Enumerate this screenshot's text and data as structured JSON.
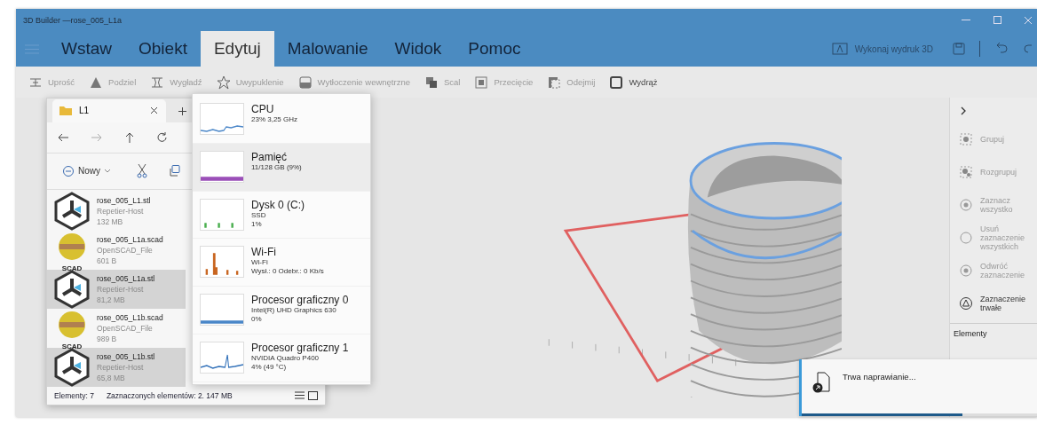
{
  "window": {
    "title": "3D Builder —rose_005_L1a"
  },
  "ribbon_tabs": [
    {
      "label": "Wstaw",
      "selected": false
    },
    {
      "label": "Obiekt",
      "selected": false
    },
    {
      "label": "Edytuj",
      "selected": true
    },
    {
      "label": "Malowanie",
      "selected": false
    },
    {
      "label": "Widok",
      "selected": false
    },
    {
      "label": "Pomoc",
      "selected": false
    }
  ],
  "print_button": {
    "label": "Wykonaj wydruk 3D"
  },
  "toolbar": [
    {
      "label": "Uprość",
      "kind": "simplify",
      "disabled": true
    },
    {
      "label": "Podziel",
      "kind": "split",
      "disabled": true
    },
    {
      "label": "Wygładź",
      "kind": "smooth",
      "disabled": true
    },
    {
      "label": "Uwypuklenie",
      "kind": "star",
      "disabled": true
    },
    {
      "label": "Wytłoczenie wewnętrzne",
      "kind": "emboss",
      "disabled": true
    },
    {
      "label": "Scal",
      "kind": "merge",
      "disabled": true
    },
    {
      "label": "Przecięcie",
      "kind": "intersect",
      "disabled": true
    },
    {
      "label": "Odejmij",
      "kind": "subtract",
      "disabled": true
    },
    {
      "label": "Wydrąż",
      "kind": "hollow",
      "disabled": false
    }
  ],
  "side_panel": {
    "items": [
      {
        "label": "Grupuj",
        "kind": "group",
        "disabled": true
      },
      {
        "label": "Rozgrupuj",
        "kind": "ungroup",
        "disabled": true
      },
      {
        "label": "Zaznacz wszystko",
        "kind": "select",
        "disabled": true
      },
      {
        "label": "Usuń zaznaczenie wszystkich",
        "kind": "circle",
        "disabled": true
      },
      {
        "label": "Odwróć zaznaczenie",
        "kind": "select",
        "disabled": true
      },
      {
        "label": "Zaznaczenie trwałe",
        "kind": "sticky",
        "disabled": false
      }
    ],
    "section_label": "Elementy"
  },
  "file_explorer": {
    "tab": "L1",
    "new_button": "Nowy",
    "files": [
      {
        "name": "rose_005_L1.stl",
        "type": "Repetier-Host",
        "size": "132 MB",
        "kind": "stl",
        "selected": false
      },
      {
        "name": "rose_005_L1a.scad",
        "type": "OpenSCAD_File",
        "size": "601 B",
        "kind": "scad",
        "icon_label": "SCAD",
        "selected": false
      },
      {
        "name": "rose_005_L1a.stl",
        "type": "Repetier-Host",
        "size": "81,2 MB",
        "kind": "stl",
        "selected": true
      },
      {
        "name": "rose_005_L1b.scad",
        "type": "OpenSCAD_File",
        "size": "989 B",
        "kind": "scad",
        "icon_label": "SCAD",
        "selected": false
      },
      {
        "name": "rose_005_L1b.stl",
        "type": "Repetier-Host",
        "size": "65,8 MB",
        "kind": "stl",
        "selected": true
      }
    ],
    "status": {
      "count": "Elementy: 7",
      "selection": "Zaznaczonych elementów: 2. 147 MB"
    }
  },
  "task_manager": {
    "items": [
      {
        "name": "CPU",
        "lines": [
          "23% 3,25 GHz"
        ],
        "color": "#4a86c8",
        "selected": false
      },
      {
        "name": "Pamięć",
        "lines": [
          "11/128 GB (9%)"
        ],
        "color": "#9b4fb8",
        "selected": true
      },
      {
        "name": "Dysk 0 (C:)",
        "lines": [
          "SSD",
          "1%"
        ],
        "color": "#4caf50",
        "selected": false
      },
      {
        "name": "Wi-Fi",
        "lines": [
          "Wi-Fi",
          "Wysł.: 0 Odebr.: 0 Kb/s"
        ],
        "color": "#c8641e",
        "selected": false
      },
      {
        "name": "Procesor graficzny 0",
        "lines": [
          "Intel(R) UHD Graphics 630",
          "0%"
        ],
        "color": "#4a86c8",
        "selected": false
      },
      {
        "name": "Procesor graficzny 1",
        "lines": [
          "NVIDIA Quadro P400",
          "4% (49 °C)"
        ],
        "color": "#2f6fb8",
        "selected": false
      }
    ]
  },
  "toast": {
    "message": "Trwa naprawianie...",
    "level": 0.64
  }
}
